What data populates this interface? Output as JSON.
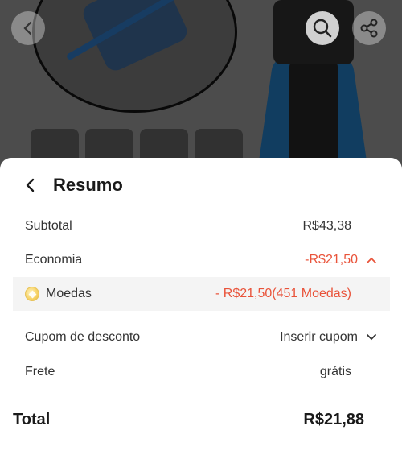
{
  "colors": {
    "accent_orange": "#e9533a",
    "highlight_row": "#f4f4f4",
    "text_primary": "#1a1a1a"
  },
  "top_bar": {
    "back_icon": "chevron-left-icon",
    "search_icon": "search-icon",
    "share_icon": "share-icon"
  },
  "sheet": {
    "title": "Resumo",
    "back_icon": "chevron-left-icon",
    "rows": {
      "subtotal": {
        "label": "Subtotal",
        "value": "R$43,38"
      },
      "economia": {
        "label": "Economia",
        "value": "-R$21,50",
        "icon": "chevron-up-icon"
      },
      "moedas": {
        "label": "Moedas",
        "value": "- R$21,50(451 Moedas)",
        "icon": "coin-icon"
      },
      "cupom": {
        "label": "Cupom de desconto",
        "value": "Inserir cupom",
        "icon": "chevron-down-icon"
      },
      "frete": {
        "label": "Frete",
        "value": "grátis"
      }
    },
    "total": {
      "label": "Total",
      "value": "R$21,88"
    }
  }
}
